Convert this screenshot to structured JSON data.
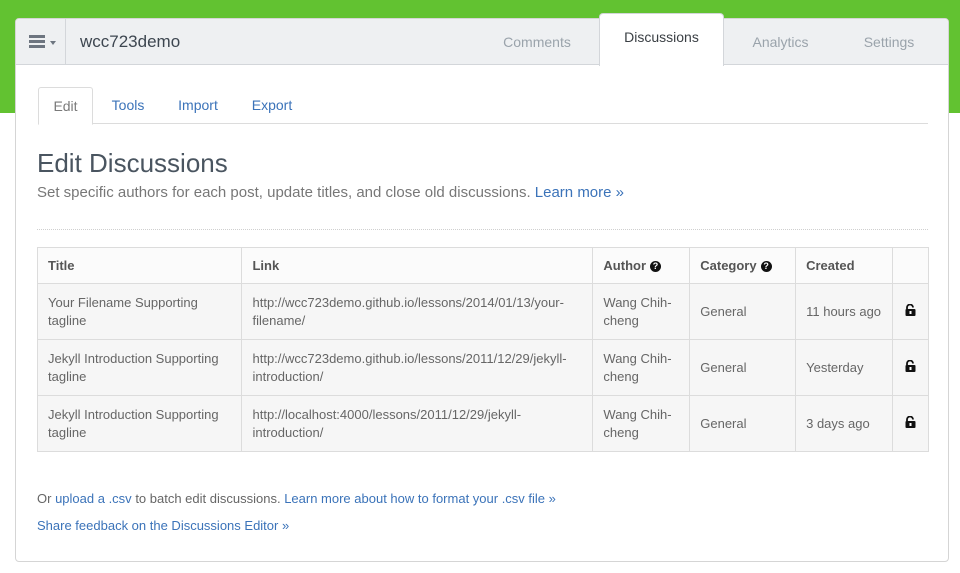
{
  "header": {
    "site_name": "wcc723demo",
    "tabs": [
      {
        "label": "Comments",
        "active": false
      },
      {
        "label": "Discussions",
        "active": true
      },
      {
        "label": "Analytics",
        "active": false
      },
      {
        "label": "Settings",
        "active": false
      }
    ]
  },
  "sub_tabs": [
    {
      "label": "Edit",
      "active": true
    },
    {
      "label": "Tools",
      "active": false
    },
    {
      "label": "Import",
      "active": false
    },
    {
      "label": "Export",
      "active": false
    }
  ],
  "page": {
    "title": "Edit Discussions",
    "description": "Set specific authors for each post, update titles, and close old discussions.",
    "learn_more": "Learn more »"
  },
  "table": {
    "columns": [
      "Title",
      "Link",
      "Author",
      "Category",
      "Created"
    ],
    "rows": [
      {
        "title": "Your Filename Supporting tagline",
        "link": "http://wcc723demo.github.io/lessons/2014/01/13/your-filename/",
        "author": "Wang Chih-cheng",
        "category": "General",
        "created": "11 hours ago"
      },
      {
        "title": "Jekyll Introduction Supporting tagline",
        "link": "http://wcc723demo.github.io/lessons/2011/12/29/jekyll-introduction/",
        "author": "Wang Chih-cheng",
        "category": "General",
        "created": "Yesterday"
      },
      {
        "title": "Jekyll Introduction Supporting tagline",
        "link": "http://localhost:4000/lessons/2011/12/29/jekyll-introduction/",
        "author": "Wang Chih-cheng",
        "category": "General",
        "created": "3 days ago"
      }
    ]
  },
  "footer": {
    "or_text": "Or",
    "upload_link": "upload a .csv",
    "batch_text": "to batch edit discussions.",
    "format_link": "Learn more about how to format your .csv file »",
    "feedback_link": "Share feedback on the Discussions Editor »"
  },
  "colors": {
    "brand_green": "#62c231",
    "link_blue": "#3b73b9"
  },
  "icons": {
    "menu": "hamburger-icon",
    "help": "question-circle-icon",
    "lock": "unlock-icon"
  }
}
